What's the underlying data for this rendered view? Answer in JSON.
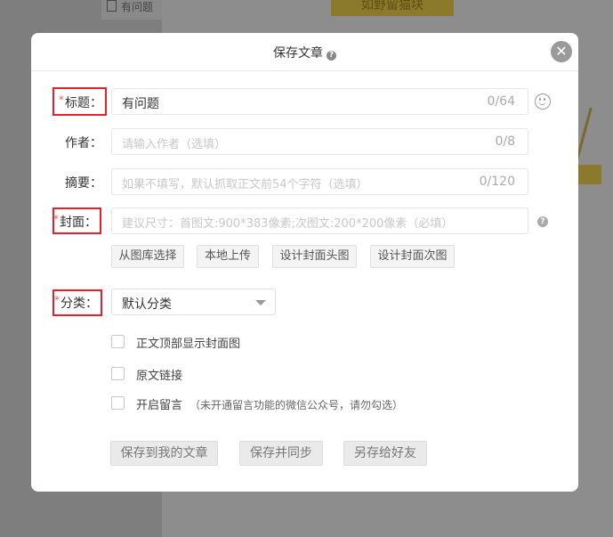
{
  "background": {
    "tab_label": "有问题",
    "banner_text": "如野留猫块"
  },
  "modal": {
    "title": "保存文章",
    "close_icon": "close-icon",
    "help_icon": "question-icon"
  },
  "form": {
    "title": {
      "label": "标题：",
      "required": true,
      "value": "有问题",
      "counter": "0/64"
    },
    "author": {
      "label": "作者：",
      "placeholder": "请输入作者（选填）",
      "counter": "0/8"
    },
    "summary": {
      "label": "摘要：",
      "placeholder": "如果不填写，默认抓取正文前54个字符（选填）",
      "counter": "0/120"
    },
    "cover": {
      "label": "封面：",
      "required": true,
      "placeholder": "建议尺寸：首图文:900*383像素;次图文:200*200像素（必填）",
      "buttons": [
        "从图库选择",
        "本地上传",
        "设计封面头图",
        "设计封面次图"
      ]
    },
    "category": {
      "label": "分类：",
      "required": true,
      "selected": "默认分类"
    },
    "options": [
      {
        "label": "正文顶部显示封面图",
        "note": "",
        "checked": false
      },
      {
        "label": "原文链接",
        "note": "",
        "checked": false
      },
      {
        "label": "开启留言",
        "note": "（未开通留言功能的微信公众号，请勿勾选）",
        "checked": false
      }
    ]
  },
  "footer": {
    "save_mine": "保存到我的文章",
    "save_sync": "保存并同步",
    "save_friend": "另存给好友"
  },
  "colors": {
    "required_star": "#e15f63",
    "highlight_box": "#e0232d",
    "overlay": "#8a8a8a"
  }
}
